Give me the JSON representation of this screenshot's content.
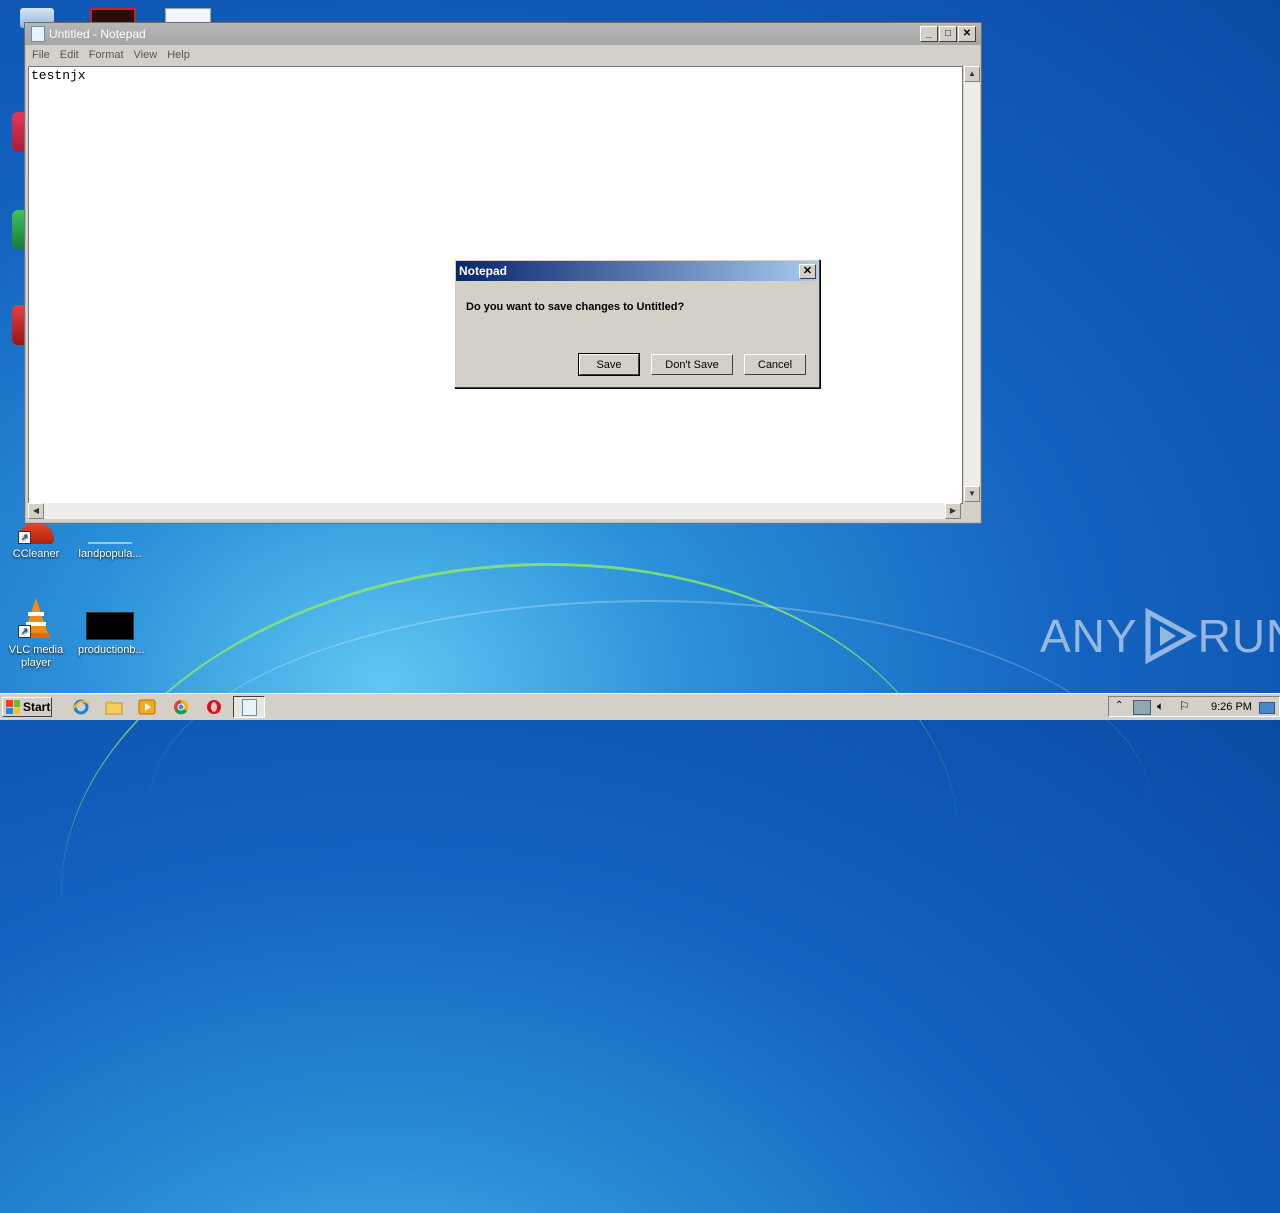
{
  "desktop": {
    "icons": [
      {
        "label": "CCleaner"
      },
      {
        "label": "landpopula..."
      },
      {
        "label": "VLC media player"
      },
      {
        "label": "productionb..."
      }
    ],
    "watermark": {
      "left": "ANY",
      "right": "RUN"
    }
  },
  "notepad": {
    "title": "Untitled - Notepad",
    "menu": [
      "File",
      "Edit",
      "Format",
      "View",
      "Help"
    ],
    "content": "testnjx",
    "controls": {
      "minimize": "_",
      "maximize": "□",
      "close": "✕"
    }
  },
  "dialog": {
    "title": "Notepad",
    "message": "Do you want to save changes to Untitled?",
    "buttons": {
      "save": "Save",
      "dont_save": "Don't Save",
      "cancel": "Cancel"
    },
    "close": "✕"
  },
  "taskbar": {
    "start_label": "Start",
    "clock": "9:26 PM"
  }
}
